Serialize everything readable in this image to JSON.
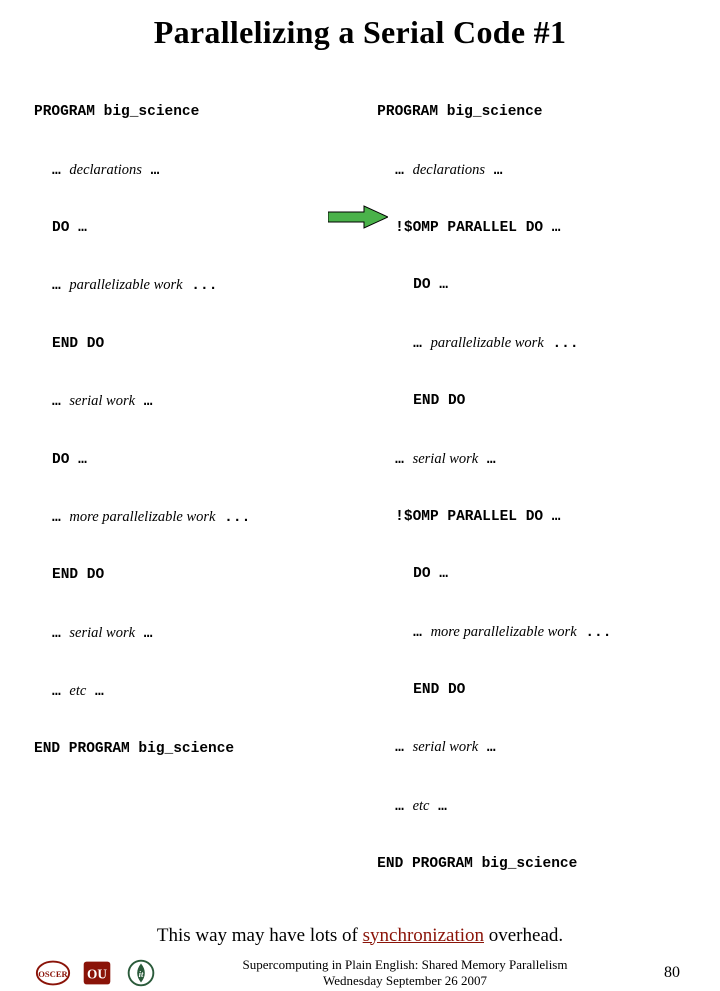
{
  "title": "Parallelizing a Serial Code #1",
  "code_left": {
    "l1": "PROGRAM big_science",
    "l2a": "… ",
    "l2b": "declarations",
    "l2c": " …",
    "l3": "DO …",
    "l4a": "… ",
    "l4b": "parallelizable work",
    "l4c": " ...",
    "l5": "END DO",
    "l6a": "… ",
    "l6b": "serial work",
    "l6c": " …",
    "l7": "DO …",
    "l8a": "… ",
    "l8b": "more parallelizable work",
    "l8c": " ...",
    "l9": "END DO",
    "l10a": "… ",
    "l10b": "serial work",
    "l10c": " …",
    "l11a": "… ",
    "l11b": "etc",
    "l11c": " …",
    "l12": "END PROGRAM big_science"
  },
  "code_right": {
    "r1": "PROGRAM big_science",
    "r2a": "… ",
    "r2b": "declarations",
    "r2c": " …",
    "r3": "!$OMP PARALLEL DO …",
    "r4": "DO …",
    "r5a": "… ",
    "r5b": "parallelizable work",
    "r5c": " ...",
    "r6": "END DO",
    "r7a": "… ",
    "r7b": "serial work",
    "r7c": " …",
    "r8": "!$OMP PARALLEL DO …",
    "r9": "DO …",
    "r10a": "… ",
    "r10b": "more parallelizable work",
    "r10c": " ...",
    "r11": "END DO",
    "r12a": "… ",
    "r12b": "serial work",
    "r12c": " …",
    "r13a": "… ",
    "r13b": "etc",
    "r13c": " …",
    "r14": "END PROGRAM big_science"
  },
  "caption": {
    "pre": "This way may have lots of ",
    "emph": "synchronization",
    "post": " overhead."
  },
  "footer": {
    "line1": "Supercomputing in Plain English: Shared Memory Parallelism",
    "line2": "Wednesday September 26 2007",
    "page": "80"
  }
}
